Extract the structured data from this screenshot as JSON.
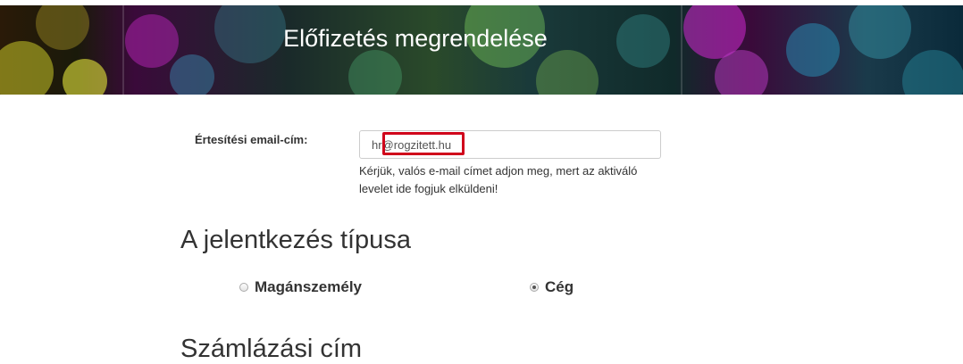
{
  "banner": {
    "title": "Előfizetés megrendelése"
  },
  "form": {
    "email_label": "Értesítési email-cím:",
    "email_value": "hr@rogzitett.hu",
    "email_help": "Kérjük, valós e-mail címet adjon meg, mert az aktiváló levelet ide fogjuk elküldeni!"
  },
  "registration": {
    "heading": "A jelentkezés típusa",
    "options": [
      {
        "label": "Magánszemély",
        "checked": false
      },
      {
        "label": "Cég",
        "checked": true
      }
    ]
  },
  "billing": {
    "heading": "Számlázási cím"
  },
  "colors": {
    "highlight": "#d0021b"
  }
}
